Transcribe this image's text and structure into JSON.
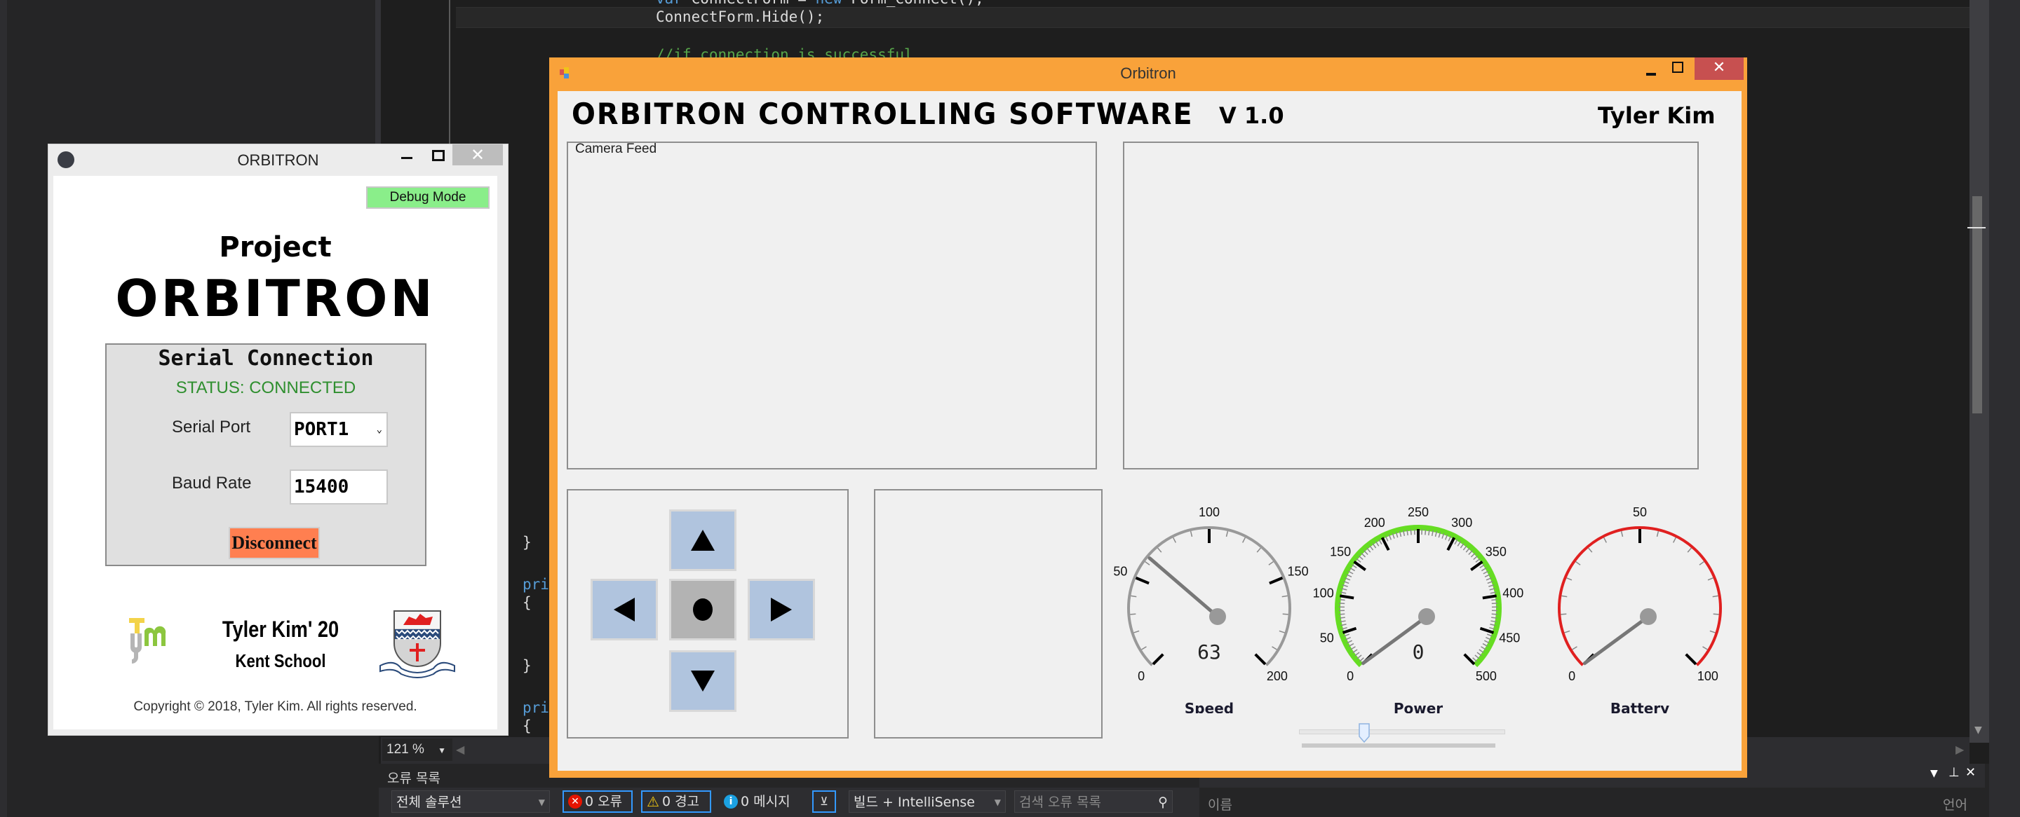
{
  "ide": {
    "code_lines": [
      {
        "text": "var ConnectForm = new Form_Connect();",
        "kind": "code"
      },
      {
        "text": "ConnectForm.Hide();",
        "kind": "code"
      },
      {
        "text": "//if connection is successful",
        "kind": "comment"
      }
    ],
    "left_code_fragments": [
      "}",
      "pri",
      "{",
      "}",
      "pri",
      "{"
    ],
    "zoom_level": "121 %",
    "error_list": {
      "title": "오류 목록",
      "scope": "전체 솔루션",
      "errors": "0 오류",
      "warnings": "0 경고",
      "messages": "0 메시지",
      "build_filter": "빌드 + IntelliSense",
      "search_placeholder": "검색 오류 목록"
    },
    "output_panel": {
      "column_name": "이름",
      "column_lang": "언어"
    }
  },
  "connect_window": {
    "title": "ORBITRON",
    "debug_button": "Debug Mode",
    "project_label": "Project",
    "product_name": "ORBITRON",
    "serial_section_title": "Serial Connection",
    "status": "STATUS: CONNECTED",
    "serial_port_label": "Serial Port",
    "serial_port_value": "PORT1",
    "baud_rate_label": "Baud Rate",
    "baud_rate_value": "15400",
    "disconnect_button": "Disconnect",
    "credit_name": "Tyler Kim' 20",
    "credit_school": "Kent School",
    "copyright": "Copyright © 2018, Tyler Kim. All rights reserved.",
    "colors": {
      "debug": "#8aee8a",
      "disconnect": "#ff7f50",
      "status": "#2f8f2f"
    }
  },
  "main_window": {
    "title": "Orbitron",
    "heading": "ORBITRON CONTROLLING SOFTWARE",
    "version": "V 1.0",
    "author": "Tyler Kim",
    "camera_label": "Camera Feed",
    "accent_color": "#f9a23a",
    "dpad": {
      "up": "up-arrow",
      "left": "left-arrow",
      "stop": "stop",
      "right": "right-arrow",
      "down": "down-arrow"
    },
    "gauges": [
      {
        "name": "Speed",
        "min": 0,
        "max": 200,
        "value": 63,
        "display": "63",
        "ticks": [
          "0",
          "50",
          "100",
          "150",
          "200"
        ],
        "arc_color": "#999999",
        "show_value": true
      },
      {
        "name": "Power",
        "min": 0,
        "max": 500,
        "value": 0,
        "display": "0",
        "ticks": [
          "0",
          "50",
          "100",
          "150",
          "200",
          "250",
          "300",
          "350",
          "400",
          "450",
          "500"
        ],
        "arc_color": "#66dd22",
        "show_value": true
      },
      {
        "name": "Battery",
        "min": 0,
        "max": 100,
        "value": 0,
        "display": "",
        "ticks": [
          "0",
          "50",
          "100"
        ],
        "arc_color": "#e02020",
        "show_value": false
      }
    ],
    "slider_value_fraction": 0.32
  }
}
